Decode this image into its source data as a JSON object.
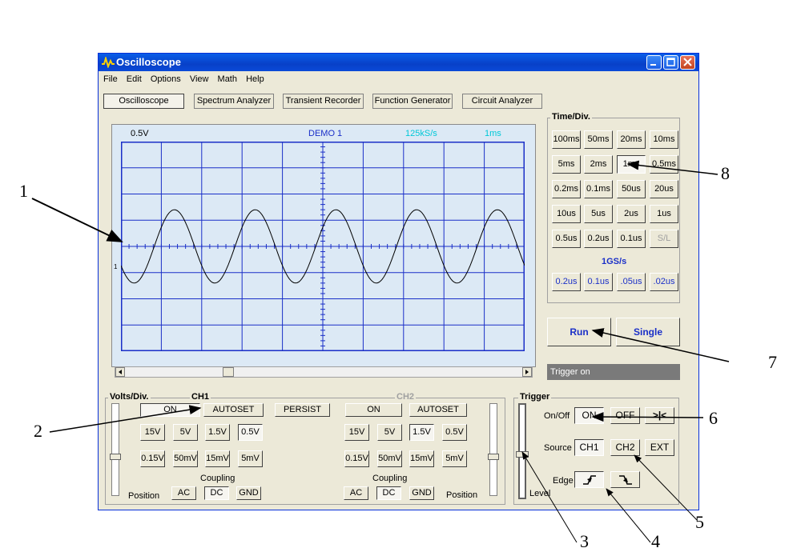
{
  "window": {
    "title": "Oscilloscope"
  },
  "menu": [
    "File",
    "Edit",
    "Options",
    "View",
    "Math",
    "Help"
  ],
  "modes": [
    "Oscilloscope",
    "Spectrum Analyzer",
    "Transient Recorder",
    "Function Generator",
    "Circuit Analyzer"
  ],
  "active_mode": "Oscilloscope",
  "scope_header": {
    "volts": "0.5V",
    "name": "DEMO 1",
    "rate": "125kS/s",
    "timebase": "1ms"
  },
  "channel_marker": "1",
  "timediv": {
    "title": "Time/Div.",
    "rows": [
      [
        "100ms",
        "50ms",
        "20ms",
        "10ms"
      ],
      [
        "5ms",
        "2ms",
        "1ms",
        "0.5ms"
      ],
      [
        "0.2ms",
        "0.1ms",
        "50us",
        "20us"
      ],
      [
        "10us",
        "5us",
        "2us",
        "1us"
      ],
      [
        "0.5us",
        "0.2us",
        "0.1us",
        "S/L"
      ]
    ],
    "selected": "1ms",
    "fast_label": "1GS/s",
    "fast_row": [
      "0.2us",
      "0.1us",
      ".05us",
      ".02us"
    ]
  },
  "run": {
    "run_label": "Run",
    "single_label": "Single"
  },
  "status": "Trigger on",
  "volts": {
    "title": "Volts/Div.",
    "ch1": {
      "title": "CH1",
      "on": "ON",
      "autoset": "AUTOSET",
      "row1": [
        "15V",
        "5V",
        "1.5V",
        "0.5V"
      ],
      "row2": [
        "0.15V",
        "50mV",
        "15mV",
        "5mV"
      ],
      "selected": "0.5V"
    },
    "persist": "PERSIST",
    "ch2": {
      "title": "CH2",
      "on": "ON",
      "autoset": "AUTOSET",
      "row1": [
        "15V",
        "5V",
        "1.5V",
        "0.5V"
      ],
      "row2": [
        "0.15V",
        "50mV",
        "15mV",
        "5mV"
      ],
      "selected": "1.5V"
    },
    "coupling": "Coupling",
    "coupling_opts": [
      "AC",
      "DC",
      "GND"
    ],
    "coupling_selected": "DC",
    "position": "Position"
  },
  "trigger": {
    "title": "Trigger",
    "onoff_label": "On/Off",
    "on": "ON",
    "off": "OFF",
    "extra": ">|<",
    "source_label": "Source",
    "sources": [
      "CH1",
      "CH2",
      "EXT"
    ],
    "edge_label": "Edge",
    "level_label": "Level"
  },
  "annotations": [
    "1",
    "2",
    "3",
    "4",
    "5",
    "6",
    "7",
    "8"
  ],
  "colors": {
    "title_bar": "#0a4ad8",
    "scope_bg": "#dce9f5",
    "grid": "#1a2fc8",
    "trace": "#000000",
    "blue_text": "#1a2fc8",
    "cyan_text": "#00c8d8"
  }
}
